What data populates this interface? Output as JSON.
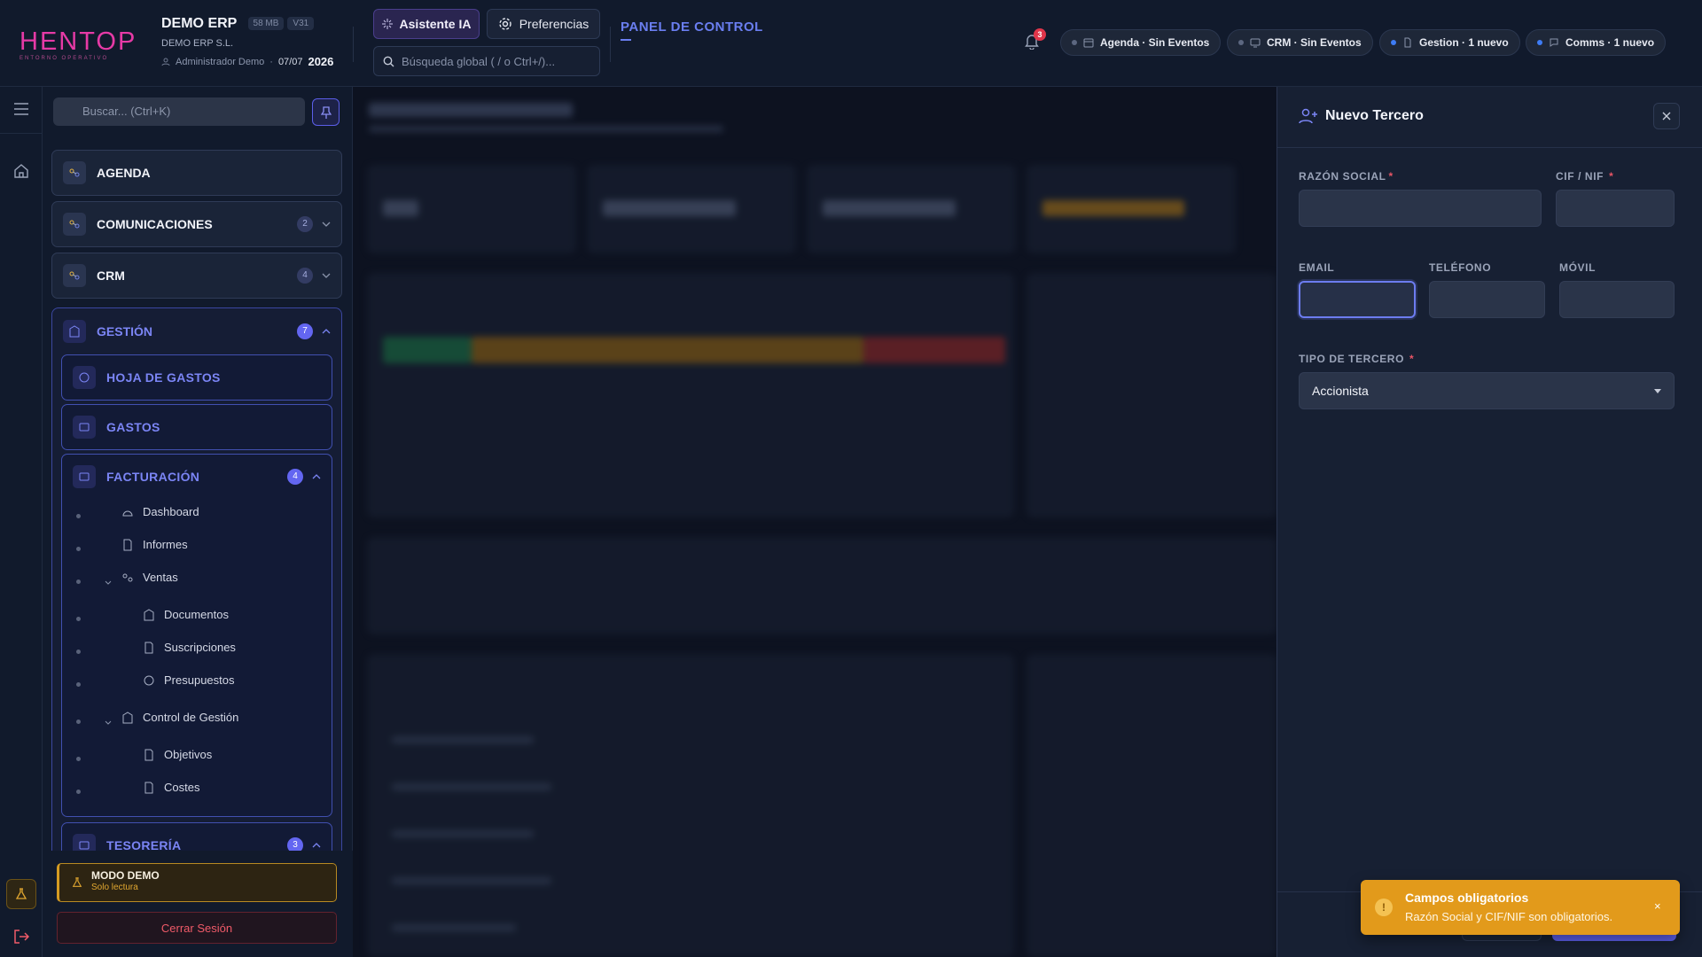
{
  "brand": {
    "logo_text": "HENTOP",
    "logo_sub": "ENTORNO OPERATIVO"
  },
  "header": {
    "app_name": "DEMO ERP",
    "chip_size": "58 MB",
    "chip_version": "V31",
    "company": "DEMO ERP S.L.",
    "user": "Administrador Demo",
    "date": "07/07",
    "year": "2026",
    "ai_button": "Asistente IA",
    "prefs_button": "Preferencias",
    "search_placeholder": "Búsqueda global ( / o Ctrl+/)...",
    "panel_title": "PANEL DE CONTROL",
    "notif_count": "3",
    "stats": [
      {
        "label": "Agenda · Sin Eventos",
        "dot": "gray",
        "icon": "calendar-icon"
      },
      {
        "label": "CRM · Sin Eventos",
        "dot": "gray",
        "icon": "monitor-icon"
      },
      {
        "label": "Gestion · 1 nuevo",
        "dot": "blue",
        "icon": "document-icon"
      },
      {
        "label": "Comms · 1 nuevo",
        "dot": "blue",
        "icon": "chat-icon"
      }
    ]
  },
  "sidebar": {
    "search_placeholder": "Buscar... (Ctrl+K)",
    "items": [
      {
        "label": "AGENDA"
      },
      {
        "label": "COMUNICACIONES",
        "badge": "2"
      },
      {
        "label": "CRM",
        "badge": "4"
      }
    ],
    "gestion": {
      "label": "GESTIÓN",
      "badge": "7",
      "subs": [
        {
          "label": "HOJA DE GASTOS"
        },
        {
          "label": "GASTOS"
        },
        {
          "label": "FACTURACIÓN",
          "badge": "4"
        }
      ],
      "tree": {
        "dashboard": "Dashboard",
        "informes": "Informes",
        "ventas": "Ventas",
        "documentos": "Documentos",
        "suscripciones": "Suscripciones",
        "presupuestos": "Presupuestos",
        "control": "Control de Gestión",
        "objetivos": "Objetivos",
        "costes": "Costes"
      },
      "tesoreria": {
        "label": "TESORERÍA",
        "badge": "3"
      }
    },
    "demo_title": "MODO DEMO",
    "demo_sub": "Solo lectura",
    "logout": "Cerrar Sesión"
  },
  "drawer": {
    "title": "Nuevo Tercero",
    "fields": {
      "razon_social": "RAZÓN SOCIAL",
      "cif": "CIF / NIF",
      "email": "EMAIL",
      "telefono": "TELÉFONO",
      "movil": "MÓVIL",
      "tipo": "TIPO DE TERCERO"
    },
    "required_mark": "*",
    "tipo_value": "Accionista"
  },
  "toast": {
    "title": "Campos obligatorios",
    "message": "Razón Social y CIF/NIF son obligatorios.",
    "close": "×"
  },
  "colors": {
    "accent": "#6366f1",
    "brand": "#e63aa6",
    "warning": "#e29a1b",
    "danger": "#ef5a68"
  }
}
